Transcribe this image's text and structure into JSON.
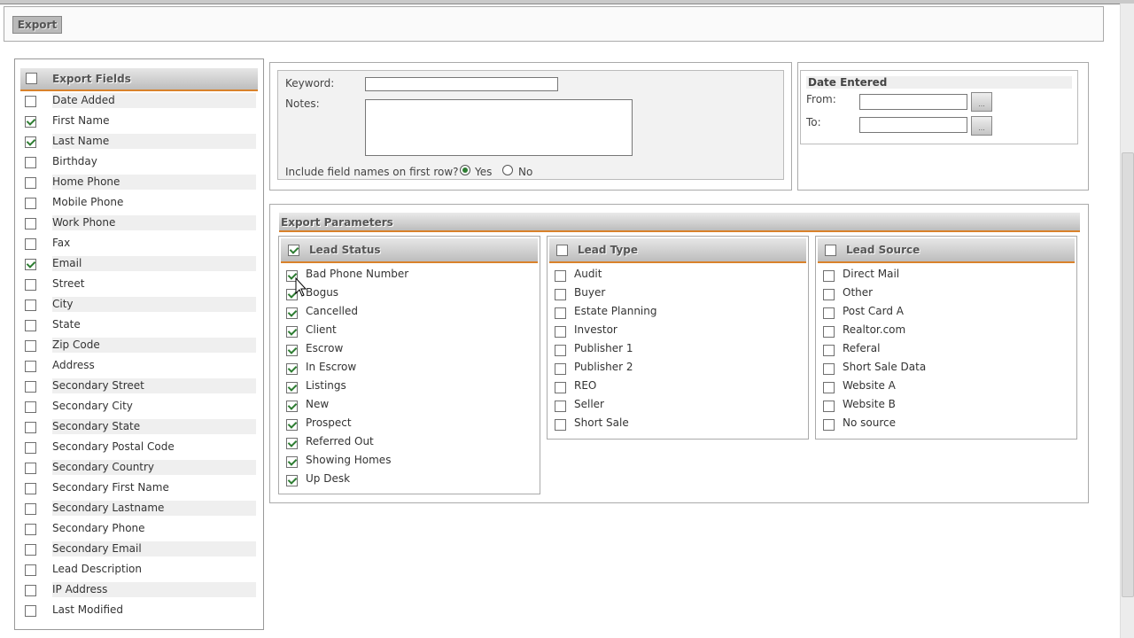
{
  "toolbar": {
    "export_label": "Export"
  },
  "export_fields": {
    "header": "Export Fields",
    "header_checked": false,
    "items": [
      {
        "label": "Date Added",
        "checked": false
      },
      {
        "label": "First Name",
        "checked": true
      },
      {
        "label": "Last Name",
        "checked": true
      },
      {
        "label": "Birthday",
        "checked": false
      },
      {
        "label": "Home Phone",
        "checked": false
      },
      {
        "label": "Mobile Phone",
        "checked": false
      },
      {
        "label": "Work Phone",
        "checked": false
      },
      {
        "label": "Fax",
        "checked": false
      },
      {
        "label": "Email",
        "checked": true
      },
      {
        "label": "Street",
        "checked": false
      },
      {
        "label": "City",
        "checked": false
      },
      {
        "label": "State",
        "checked": false
      },
      {
        "label": "Zip Code",
        "checked": false
      },
      {
        "label": "Address",
        "checked": false
      },
      {
        "label": "Secondary Street",
        "checked": false
      },
      {
        "label": "Secondary City",
        "checked": false
      },
      {
        "label": "Secondary State",
        "checked": false
      },
      {
        "label": "Secondary Postal Code",
        "checked": false
      },
      {
        "label": "Secondary Country",
        "checked": false
      },
      {
        "label": "Secondary First Name",
        "checked": false
      },
      {
        "label": "Secondary Lastname",
        "checked": false
      },
      {
        "label": "Secondary Phone",
        "checked": false
      },
      {
        "label": "Secondary Email",
        "checked": false
      },
      {
        "label": "Lead Description",
        "checked": false
      },
      {
        "label": "IP Address",
        "checked": false
      },
      {
        "label": "Last Modified",
        "checked": false
      }
    ]
  },
  "options": {
    "keyword_label": "Keyword:",
    "keyword_value": "",
    "notes_label": "Notes:",
    "notes_value": "",
    "include_label": "Include field names on first row?",
    "yes_label": "Yes",
    "no_label": "No",
    "include_selected": "Yes"
  },
  "date_entered": {
    "title": "Date Entered",
    "from_label": "From:",
    "to_label": "To:",
    "from_value": "",
    "to_value": "",
    "picker_label": "..."
  },
  "export_parameters": {
    "header": "Export Parameters",
    "groups": [
      {
        "title": "Lead Status",
        "header_checked": true,
        "items": [
          {
            "label": "Bad Phone Number",
            "checked": true
          },
          {
            "label": "Bogus",
            "checked": true
          },
          {
            "label": "Cancelled",
            "checked": true
          },
          {
            "label": "Client",
            "checked": true
          },
          {
            "label": "Escrow",
            "checked": true
          },
          {
            "label": "In Escrow",
            "checked": true
          },
          {
            "label": "Listings",
            "checked": true
          },
          {
            "label": "New",
            "checked": true
          },
          {
            "label": "Prospect",
            "checked": true
          },
          {
            "label": "Referred Out",
            "checked": true
          },
          {
            "label": "Showing Homes",
            "checked": true
          },
          {
            "label": "Up Desk",
            "checked": true
          }
        ]
      },
      {
        "title": "Lead Type",
        "header_checked": false,
        "items": [
          {
            "label": "Audit",
            "checked": false
          },
          {
            "label": "Buyer",
            "checked": false
          },
          {
            "label": "Estate Planning",
            "checked": false
          },
          {
            "label": "Investor",
            "checked": false
          },
          {
            "label": "Publisher 1",
            "checked": false
          },
          {
            "label": "Publisher 2",
            "checked": false
          },
          {
            "label": "REO",
            "checked": false
          },
          {
            "label": "Seller",
            "checked": false
          },
          {
            "label": "Short Sale",
            "checked": false
          }
        ]
      },
      {
        "title": "Lead Source",
        "header_checked": false,
        "items": [
          {
            "label": "Direct Mail",
            "checked": false
          },
          {
            "label": "Other",
            "checked": false
          },
          {
            "label": "Post Card A",
            "checked": false
          },
          {
            "label": "Realtor.com",
            "checked": false
          },
          {
            "label": "Referal",
            "checked": false
          },
          {
            "label": "Short Sale Data",
            "checked": false
          },
          {
            "label": "Website A",
            "checked": false
          },
          {
            "label": "Website B",
            "checked": false
          },
          {
            "label": "No source",
            "checked": false
          }
        ]
      }
    ]
  }
}
